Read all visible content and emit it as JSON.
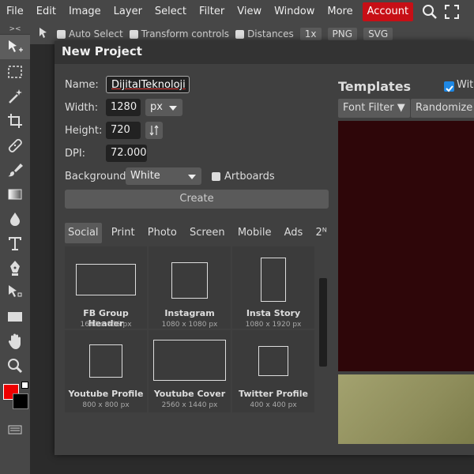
{
  "menu": [
    "File",
    "Edit",
    "Image",
    "Layer",
    "Select",
    "Filter",
    "View",
    "Window",
    "More"
  ],
  "account_label": "Account",
  "options": {
    "auto_select": "Auto Select",
    "transform_controls": "Transform controls",
    "distances": "Distances",
    "zoom": "1x",
    "png": "PNG",
    "svg": "SVG"
  },
  "toolbar": {
    "collapse": "><"
  },
  "dialog": {
    "title": "New Project",
    "name_label": "Name:",
    "name_value": "DijitalTeknoloji",
    "width_label": "Width:",
    "width_value": "1280",
    "unit_value": "px",
    "height_label": "Height:",
    "height_value": "720",
    "dpi_label": "DPI:",
    "dpi_value": "72.000",
    "background_label": "Background:",
    "background_value": "White",
    "artboards_label": "Artboards",
    "create_label": "Create",
    "tabs": [
      "Social",
      "Print",
      "Photo",
      "Screen",
      "Mobile",
      "Ads",
      "2ᴺ"
    ],
    "presets": [
      {
        "name": "FB Group Header",
        "size": "1640 x 856 px"
      },
      {
        "name": "Instagram",
        "size": "1080 x 1080 px"
      },
      {
        "name": "Insta Story",
        "size": "1080 x 1920 px"
      },
      {
        "name": "Youtube Profile",
        "size": "800 x 800 px"
      },
      {
        "name": "Youtube Cover",
        "size": "2560 x 1440 px"
      },
      {
        "name": "Twitter Profile",
        "size": "400 x 400 px"
      }
    ],
    "templates_title": "Templates",
    "with_label": "With",
    "font_filter_label": "Font Filter ▼",
    "randomize_label": "Randomize"
  },
  "colors": {
    "foreground": "#ee0000",
    "background": "#000000",
    "account": "#c70f16"
  }
}
